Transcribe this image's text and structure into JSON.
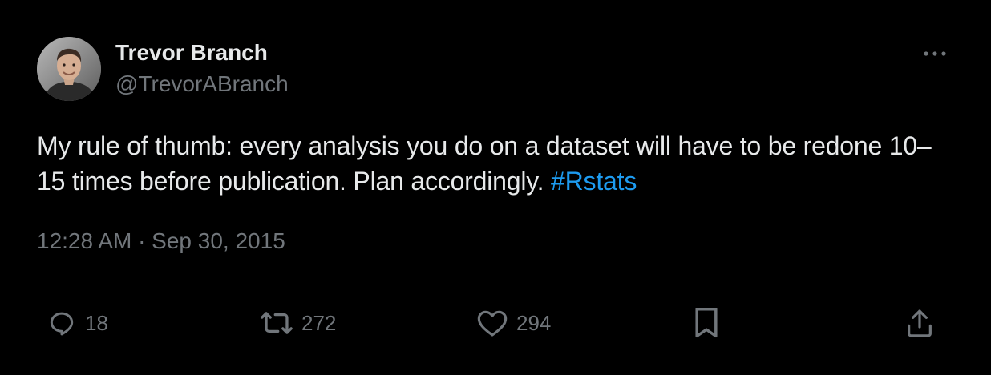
{
  "author": {
    "display_name": "Trevor Branch",
    "handle": "@TrevorABranch"
  },
  "tweet": {
    "text_before": "My rule of thumb: every analysis you do on a dataset will have to be redone 10–15 times before publication. Plan accordingly. ",
    "hashtag": "#Rstats"
  },
  "meta": {
    "time": "12:28 AM · Sep 30, 2015"
  },
  "actions": {
    "reply_count": "18",
    "retweet_count": "272",
    "like_count": "294"
  },
  "colors": {
    "background": "#000000",
    "text": "#e7e9ea",
    "secondary": "#71767b",
    "accent": "#1d9bf0",
    "border": "#2f3336"
  },
  "icons": [
    "more-icon",
    "reply-icon",
    "retweet-icon",
    "like-icon",
    "bookmark-icon",
    "share-icon"
  ]
}
